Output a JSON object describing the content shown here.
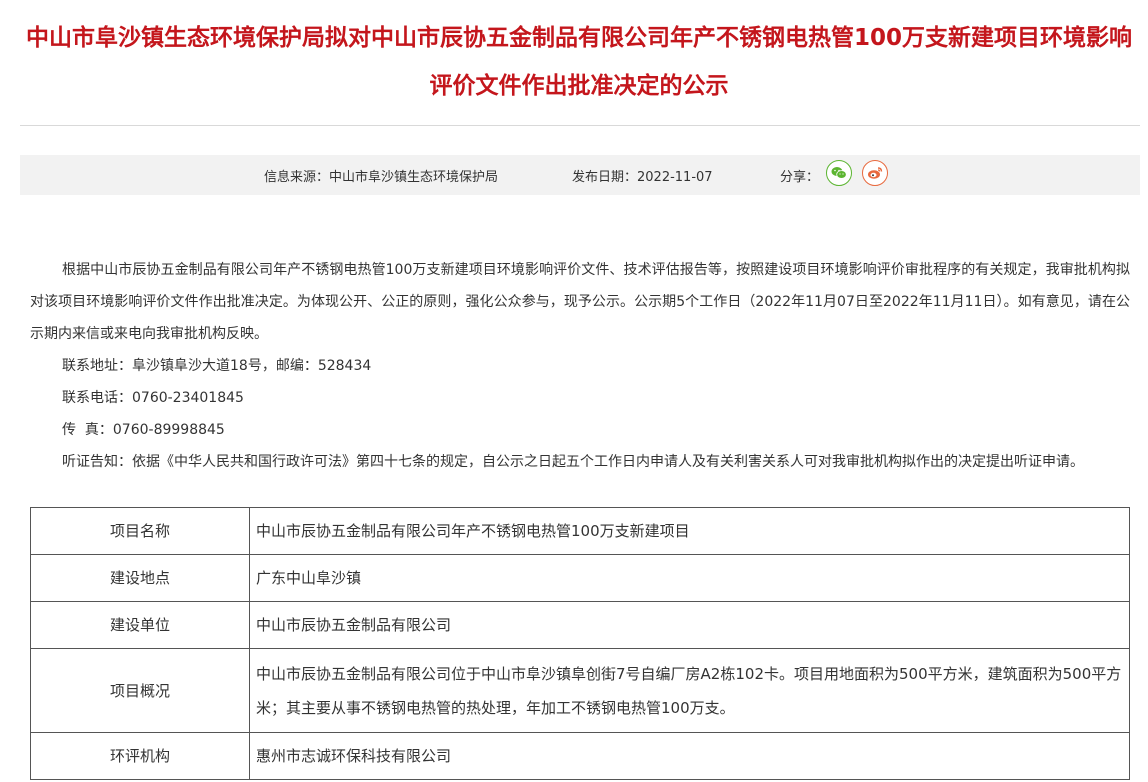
{
  "title": "中山市阜沙镇生态环境保护局拟对中山市辰协五金制品有限公司年产不锈钢电热管100万支新建项目环境影响评价文件作出批准决定的公示",
  "info": {
    "source_label": "信息来源：",
    "source_value": "中山市阜沙镇生态环境保护局",
    "date_label": "发布日期：",
    "date_value": "2022-11-07",
    "share_label": "分享："
  },
  "body": {
    "p1": "根据中山市辰协五金制品有限公司年产不锈钢电热管100万支新建项目环境影响评价文件、技术评估报告等，按照建设项目环境影响评价审批程序的有关规定，我审批机构拟对该项目环境影响评价文件作出批准决定。为体现公开、公正的原则，强化公众参与，现予公示。公示期5个工作日（2022年11月07日至2022年11月11日）。如有意见，请在公示期内来信或来电向我审批机构反映。",
    "address": "联系地址：阜沙镇阜沙大道18号，邮编：528434",
    "phone": "联系电话：0760-23401845",
    "fax": "传  真：0760-89998845",
    "hearing": "听证告知：依据《中华人民共和国行政许可法》第四十七条的规定，自公示之日起五个工作日内申请人及有关利害关系人可对我审批机构拟作出的决定提出听证申请。"
  },
  "table": {
    "rows": [
      {
        "key": "项目名称",
        "value": "中山市辰协五金制品有限公司年产不锈钢电热管100万支新建项目"
      },
      {
        "key": "建设地点",
        "value": "广东中山阜沙镇"
      },
      {
        "key": "建设单位",
        "value": "中山市辰协五金制品有限公司"
      },
      {
        "key": "项目概况",
        "value": "中山市辰协五金制品有限公司位于中山市阜沙镇阜创街7号自编厂房A2栋102卡。项目用地面积为500平方米，建筑面积为500平方米；其主要从事不锈钢电热管的热处理，年加工不锈钢电热管100万支。"
      },
      {
        "key": "环评机构",
        "value": "惠州市志诚环保科技有限公司"
      }
    ]
  },
  "colors": {
    "title": "#c4161c",
    "wechat": "#5cb531",
    "weibo": "#e8693e"
  },
  "icons": [
    "wechat-icon",
    "weibo-icon"
  ]
}
